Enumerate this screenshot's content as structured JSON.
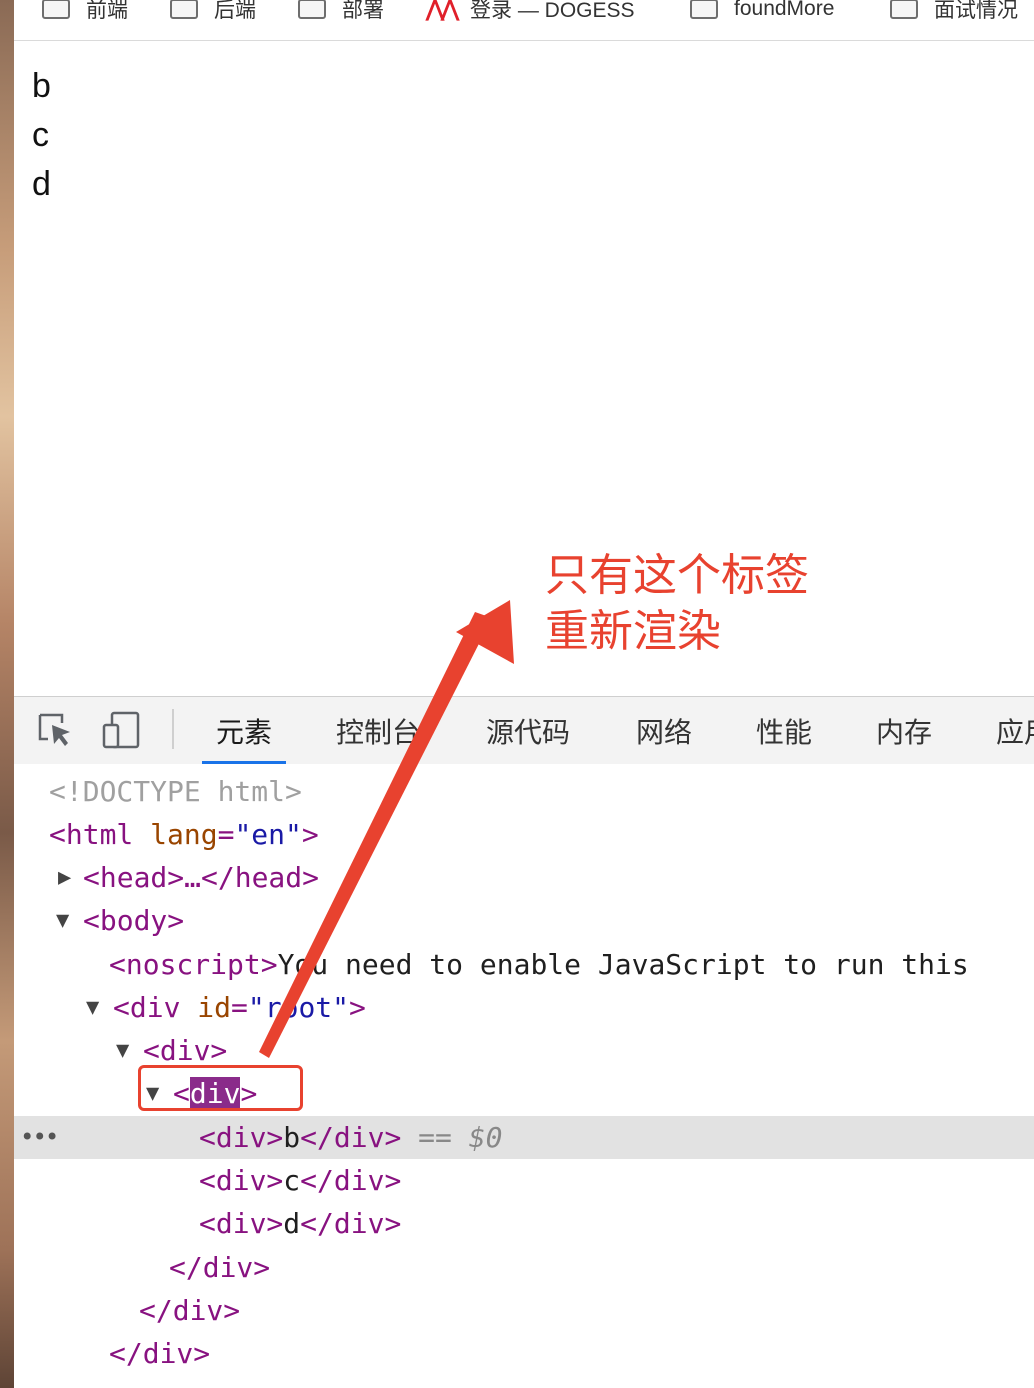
{
  "bookmarks": [
    {
      "label": "前端",
      "icon": "folder-icon"
    },
    {
      "label": "后端",
      "icon": "folder-icon"
    },
    {
      "label": "部署",
      "icon": "folder-icon"
    },
    {
      "label": "登录 — DOGESS",
      "icon": "site-logo-icon"
    },
    {
      "label": "foundMore",
      "icon": "folder-icon"
    },
    {
      "label": "面试情况",
      "icon": "folder-icon"
    }
  ],
  "page": {
    "lines": [
      "b",
      "c",
      "d"
    ]
  },
  "annotation": {
    "line1": "只有这个标签",
    "line2": "重新渲染",
    "color": "#e8422f"
  },
  "devtools": {
    "tabs": [
      "元素",
      "控制台",
      "源代码",
      "网络",
      "性能",
      "内存",
      "应用"
    ],
    "active_tab": "元素",
    "elements": {
      "doctype": "<!DOCTYPE html>",
      "html_open": "<html",
      "html_attr": "lang",
      "html_val": "\"en\"",
      "html_close": ">",
      "head": "<head>…</head>",
      "body_open": "<body>",
      "noscript_tag": "<noscript>",
      "noscript_text": "You need to enable JavaScript to run this",
      "root_open": "<div",
      "root_attr": "id",
      "root_val": "\"root\"",
      "root_close": ">",
      "div_open": "<div>",
      "inner_lt": "<",
      "inner_name": "div",
      "inner_gt": ">",
      "child_b_open": "<div>",
      "child_b_text": "b",
      "child_b_close": "</div>",
      "selected_marker": "==",
      "selected_ref": "$0",
      "child_c_open": "<div>",
      "child_c_text": "c",
      "child_c_close": "</div>",
      "child_d_open": "<div>",
      "child_d_text": "d",
      "child_d_close": "</div>",
      "close_div_1": "</div>",
      "close_div_2": "</div>",
      "close_div_3": "</div>"
    }
  }
}
